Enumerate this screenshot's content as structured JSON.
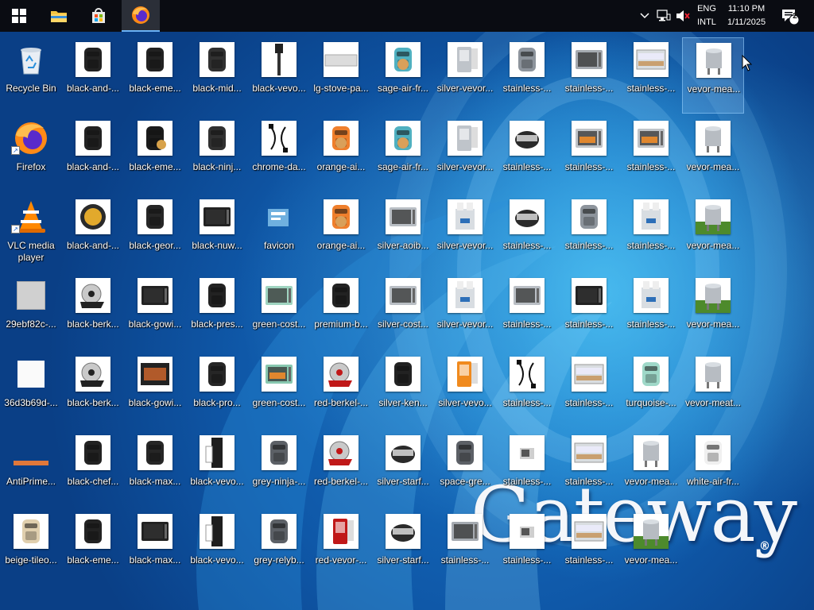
{
  "taskbar": {
    "apps": [
      {
        "name": "start-button",
        "icon": "windows-logo-icon"
      },
      {
        "name": "file-explorer-button",
        "icon": "folder-icon"
      },
      {
        "name": "microsoft-store-button",
        "icon": "store-bag-icon"
      },
      {
        "name": "firefox-taskbar-button",
        "icon": "firefox-icon",
        "active": true
      }
    ],
    "tray": {
      "language_top": "ENG",
      "language_bottom": "INTL",
      "time": "11:10 PM",
      "date": "1/11/2025",
      "notification_count": "2"
    }
  },
  "wallpaper": {
    "brand": "Gateway",
    "registered_mark": "®"
  },
  "columns": [
    [
      {
        "label": "Recycle Bin",
        "kind": "recycle"
      },
      {
        "label": "Firefox",
        "kind": "firefox",
        "shortcut": true
      },
      {
        "label": "VLC media player",
        "kind": "vlc",
        "shortcut": true,
        "wrap": true
      },
      {
        "label": "29ebf82c-...",
        "kind": "grayfile"
      },
      {
        "label": "36d3b69d-...",
        "kind": "whitefile"
      },
      {
        "label": "AntiPrime...",
        "kind": "bar"
      },
      {
        "label": "beige-tileo...",
        "kind": "beigefryer"
      }
    ],
    [
      {
        "label": "black-and-...",
        "kind": "airfryer-dark"
      },
      {
        "label": "black-and-...",
        "kind": "airfryer-dark"
      },
      {
        "label": "black-and-...",
        "kind": "food-pot"
      },
      {
        "label": "black-berk...",
        "kind": "slicer"
      },
      {
        "label": "black-berk...",
        "kind": "slicer"
      },
      {
        "label": "black-chef...",
        "kind": "airfryer-dark"
      },
      {
        "label": "black-eme...",
        "kind": "airfryer-dark"
      }
    ],
    [
      {
        "label": "black-eme...",
        "kind": "airfryer-dark"
      },
      {
        "label": "black-eme...",
        "kind": "airfryer-food"
      },
      {
        "label": "black-geor...",
        "kind": "airfryer-round"
      },
      {
        "label": "black-gowi...",
        "kind": "oven-dark"
      },
      {
        "label": "black-gowi...",
        "kind": "grill-food"
      },
      {
        "label": "black-max...",
        "kind": "airfryer-round"
      },
      {
        "label": "black-max...",
        "kind": "oven-dark"
      }
    ],
    [
      {
        "label": "black-mid...",
        "kind": "airfryer-small"
      },
      {
        "label": "black-ninj...",
        "kind": "airfryer-small"
      },
      {
        "label": "black-nuw...",
        "kind": "oven-dark"
      },
      {
        "label": "black-pres...",
        "kind": "airfryer-dark"
      },
      {
        "label": "black-pro...",
        "kind": "airfryer-round"
      },
      {
        "label": "black-vevo...",
        "kind": "tall-dark"
      },
      {
        "label": "black-vevo...",
        "kind": "tall-dark"
      }
    ],
    [
      {
        "label": "black-vevo...",
        "kind": "stick"
      },
      {
        "label": "chrome-da...",
        "kind": "cable"
      },
      {
        "label": "favicon",
        "kind": "favicon"
      },
      {
        "label": "green-cost...",
        "kind": "oven-green"
      },
      {
        "label": "green-cost...",
        "kind": "oven-green-food"
      },
      {
        "label": "grey-ninja-...",
        "kind": "airfryer-grey"
      },
      {
        "label": "grey-relyb...",
        "kind": "airfryer-grey"
      }
    ],
    [
      {
        "label": "lg-stove-pa...",
        "kind": "panel"
      },
      {
        "label": "orange-ai...",
        "kind": "airfryer-orange"
      },
      {
        "label": "orange-ai...",
        "kind": "airfryer-orange"
      },
      {
        "label": "premium-b...",
        "kind": "airfryer-dark"
      },
      {
        "label": "red-berkel-...",
        "kind": "slicer-red"
      },
      {
        "label": "red-berkel-...",
        "kind": "slicer-red"
      },
      {
        "label": "red-vevor-...",
        "kind": "red-machine"
      }
    ],
    [
      {
        "label": "sage-air-fr...",
        "kind": "airfryer-teal"
      },
      {
        "label": "sage-air-fr...",
        "kind": "airfryer-teal"
      },
      {
        "label": "silver-aoib...",
        "kind": "oven-silver"
      },
      {
        "label": "silver-cost...",
        "kind": "oven-silver"
      },
      {
        "label": "silver-ken...",
        "kind": "airfryer-dark"
      },
      {
        "label": "silver-starf...",
        "kind": "grill-round"
      },
      {
        "label": "silver-starf...",
        "kind": "grill-round"
      }
    ],
    [
      {
        "label": "silver-vevor...",
        "kind": "tall-silver"
      },
      {
        "label": "silver-vevor...",
        "kind": "tall-silver"
      },
      {
        "label": "silver-vevor...",
        "kind": "icecream"
      },
      {
        "label": "silver-vevor...",
        "kind": "icecream"
      },
      {
        "label": "silver-vevo...",
        "kind": "juicer"
      },
      {
        "label": "space-gre...",
        "kind": "airfryer-grey"
      },
      {
        "label": "stainless-...",
        "kind": "oven-steel"
      }
    ],
    [
      {
        "label": "stainless-...",
        "kind": "airfryer-steel"
      },
      {
        "label": "stainless-...",
        "kind": "grill-round"
      },
      {
        "label": "stainless-...",
        "kind": "grill-round"
      },
      {
        "label": "stainless-...",
        "kind": "oven-silver"
      },
      {
        "label": "stainless-...",
        "kind": "cable"
      },
      {
        "label": "stainless-...",
        "kind": "oven-small"
      },
      {
        "label": "stainless-...",
        "kind": "oven-small"
      }
    ],
    [
      {
        "label": "stainless-...",
        "kind": "oven-steel"
      },
      {
        "label": "stainless-...",
        "kind": "oven-food"
      },
      {
        "label": "stainless-...",
        "kind": "airfryer-steel"
      },
      {
        "label": "stainless-...",
        "kind": "oven-dark"
      },
      {
        "label": "stainless-...",
        "kind": "display-case"
      },
      {
        "label": "stainless-...",
        "kind": "display-case"
      },
      {
        "label": "stainless-...",
        "kind": "display-case"
      }
    ],
    [
      {
        "label": "stainless-...",
        "kind": "display-case"
      },
      {
        "label": "stainless-...",
        "kind": "oven-food"
      },
      {
        "label": "stainless-...",
        "kind": "icecream"
      },
      {
        "label": "stainless-...",
        "kind": "icecream"
      },
      {
        "label": "turquoise-...",
        "kind": "airfryer-mint"
      },
      {
        "label": "vevor-mea...",
        "kind": "drum"
      },
      {
        "label": "vevor-mea...",
        "kind": "drum-grass"
      }
    ],
    [
      {
        "label": "vevor-mea...",
        "kind": "drum",
        "selected": true
      },
      {
        "label": "vevor-mea...",
        "kind": "drum"
      },
      {
        "label": "vevor-mea...",
        "kind": "drum-grass"
      },
      {
        "label": "vevor-mea...",
        "kind": "drum-grass"
      },
      {
        "label": "vevor-meat...",
        "kind": "drum"
      },
      {
        "label": "white-air-fr...",
        "kind": "airfryer-white"
      }
    ]
  ]
}
